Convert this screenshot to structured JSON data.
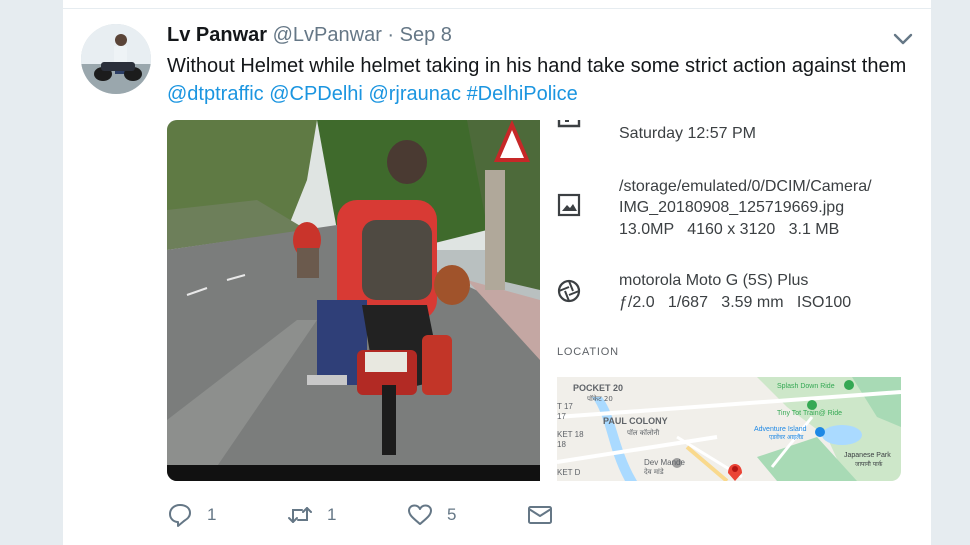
{
  "tweet": {
    "author_name": "Lv Panwar",
    "handle": "@LvPanwar",
    "separator": " · ",
    "date": "Sep 8",
    "text_plain": "Without Helmet while helmet taking in his hand take some strict action against them ",
    "mentions": [
      "@dtptraffic",
      "@CPDelhi",
      "@rjraunac",
      "#DelhiPolice"
    ]
  },
  "photo_info": {
    "datetime": "Saturday 12:57 PM",
    "file_path": "/storage/emulated/0/DCIM/Camera/",
    "file_name": "IMG_20180908_125719669.jpg",
    "file_meta": "13.0MP   4160 x 3120   3.1 MB",
    "camera_model": "motorola Moto G (5S) Plus",
    "camera_meta": "ƒ/2.0   1/687   3.59 mm   ISO100",
    "location_label": "LOCATION"
  },
  "map_labels": {
    "pocket": "POCKET 20",
    "pocket_hi": "पॉकेट 20",
    "t17": "T 17",
    "t17b": "17",
    "paul_colony": "PAUL COLONY",
    "paul_colony_hi": "पॉल कॉलोनी",
    "ket18": "KET 18",
    "ket18b": "18",
    "ket_d": "KET D",
    "dev_mande": "Dev Mande",
    "dev_mande_hi": "देव मांडे",
    "splash": "Splash Down Ride",
    "tiny_tot": "Tiny Tot Train@ Ride",
    "adventure": "Adventure Island",
    "adventure_hi": "एडवेंचर आइलैंड",
    "japanese_park": "Japanese Park",
    "japanese_park_hi": "जापानी पार्क"
  },
  "actions": {
    "replies": "1",
    "retweets": "1",
    "likes": "5"
  },
  "colors": {
    "link": "#1b95e0",
    "action_icon": "#657786",
    "map_green": "#a8dab5",
    "map_water": "#aadaff",
    "map_pin": "#ea4335"
  }
}
